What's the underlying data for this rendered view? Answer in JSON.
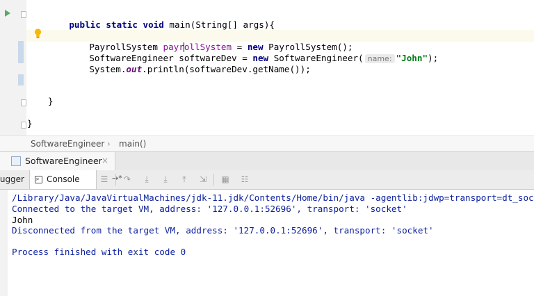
{
  "editor": {
    "lines": {
      "main_sig": {
        "kw": "public static void",
        "rest": " main(String[] args){"
      },
      "l_payroll": {
        "type": "PayrollSystem ",
        "var_a": "payr",
        "var_b": "ollSystem",
        "eq": " = ",
        "kw_new": "new",
        "rest": " PayrollSystem();"
      },
      "l_engineer": {
        "type": "SoftwareEngineer softwareDev = ",
        "kw_new": "new",
        "ctor": " SoftwareEngineer(",
        "hint": "name:",
        "str": "\"John\"",
        "end": ");"
      },
      "l_print": {
        "a": "System.",
        "field": "out",
        "b": ".println(softwareDev.getName());"
      },
      "close_method": "}",
      "close_class": "}"
    }
  },
  "breadcrumb": {
    "class": "SoftwareEngineer",
    "sep": "›",
    "method": "main()"
  },
  "run_tab": {
    "label": "SoftwareEngineer",
    "close": "×"
  },
  "debug_toolbar": {
    "debugger_label": "Debugger",
    "console_label": "Console",
    "pin": "→*"
  },
  "console": {
    "lines": [
      "/Library/Java/JavaVirtualMachines/jdk-11.jdk/Contents/Home/bin/java -agentlib:jdwp=transport=dt_socket,a",
      "Connected to the target VM, address: '127.0.0.1:52696', transport: 'socket'",
      "John",
      "Disconnected from the target VM, address: '127.0.0.1:52696', transport: 'socket'",
      "",
      "Process finished with exit code 0"
    ]
  },
  "colors": {
    "keyword": "#000080",
    "string": "#067d17",
    "console_text": "#0b1f9e",
    "run_green": "#59a869"
  }
}
